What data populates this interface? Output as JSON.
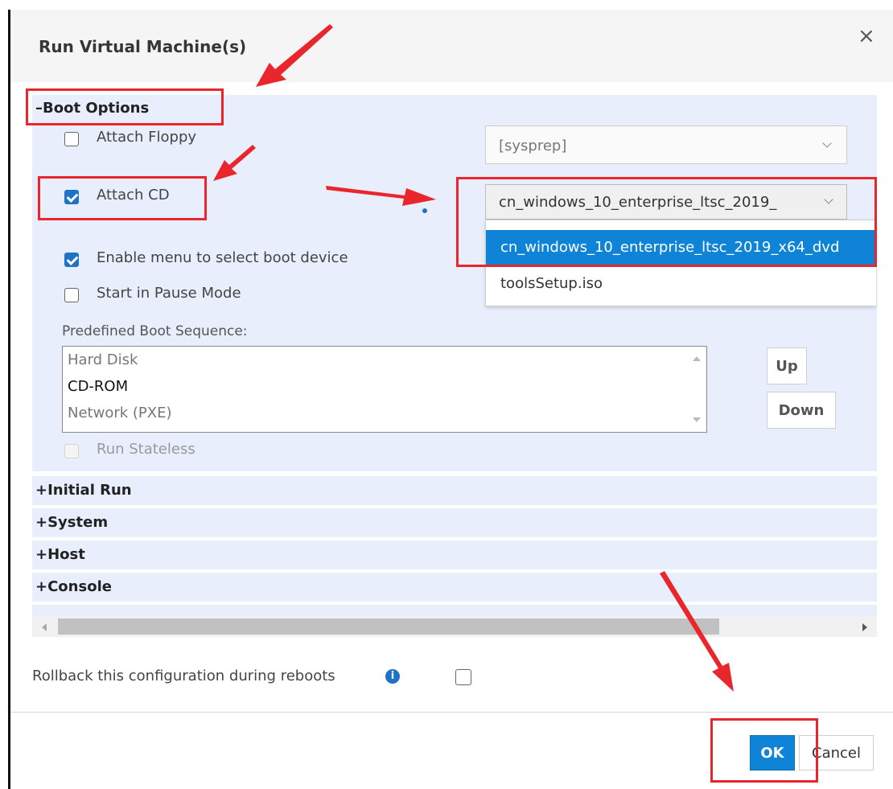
{
  "dialog": {
    "title": "Run Virtual Machine(s)",
    "close_glyph": "×"
  },
  "boot_options": {
    "header": "Boot Options",
    "expand_glyph": "–",
    "attach_floppy": {
      "label": "Attach Floppy",
      "checked": false
    },
    "floppy_select": {
      "value": "[sysprep]"
    },
    "attach_cd": {
      "label": "Attach CD",
      "checked": true
    },
    "cd_select": {
      "value": "cn_windows_10_enterprise_ltsc_2019_",
      "options": [
        "cn_windows_10_enterprise_ltsc_2019_x64_dvd",
        "toolsSetup.iso"
      ]
    },
    "enable_menu": {
      "label": "Enable menu to select boot device",
      "checked": true
    },
    "start_pause": {
      "label": "Start in Pause Mode",
      "checked": false
    },
    "boot_sequence": {
      "label": "Predefined Boot Sequence:",
      "items": [
        "Hard Disk",
        "CD-ROM",
        "Network (PXE)"
      ],
      "up_label": "Up",
      "down_label": "Down"
    },
    "run_stateless": {
      "label": "Run Stateless",
      "checked": false,
      "disabled": true
    }
  },
  "collapsed_sections": [
    {
      "glyph": "+",
      "label": "Initial Run"
    },
    {
      "glyph": "+",
      "label": "System"
    },
    {
      "glyph": "+",
      "label": "Host"
    },
    {
      "glyph": "+",
      "label": "Console"
    }
  ],
  "rollback": {
    "label": "Rollback this configuration during reboots",
    "info_icon": "i",
    "checked": false
  },
  "footer": {
    "ok_label": "OK",
    "cancel_label": "Cancel"
  },
  "colors": {
    "accent": "#1e73c9",
    "selection": "#0f84d6",
    "annotation": "#e8262b",
    "section_bg": "#e8eefc"
  }
}
